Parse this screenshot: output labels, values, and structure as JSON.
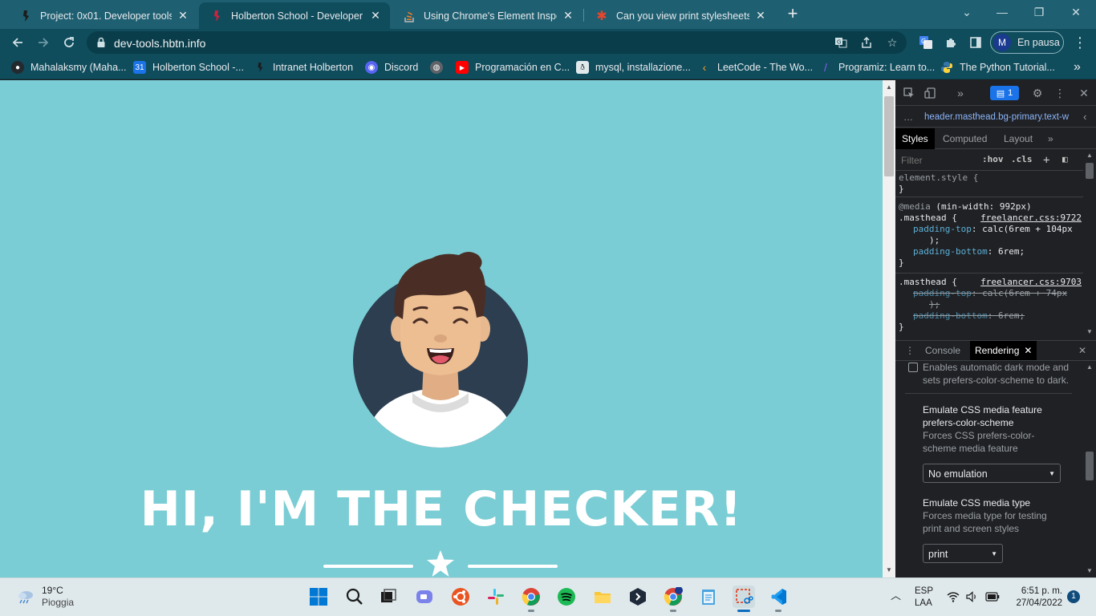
{
  "tabs": [
    {
      "title": "Project: 0x01. Developer tools | H",
      "favicon": "holberton-icon",
      "active": false
    },
    {
      "title": "Holberton School - Developer to",
      "favicon": "holberton-icon",
      "active": true
    },
    {
      "title": "Using Chrome's Element Inspecto",
      "favicon": "stackoverflow-icon",
      "active": false
    },
    {
      "title": "Can you view print stylesheets ap",
      "favicon": "asterisk-icon",
      "active": false
    }
  ],
  "toolbar": {
    "url": "dev-tools.hbtn.info",
    "profile_initial": "M",
    "profile_label": "En pausa"
  },
  "bookmarks": [
    {
      "label": "Mahalaksmy (Maha...",
      "icon": "github-icon",
      "color": "#24292e"
    },
    {
      "label": "Holberton School -...",
      "icon": "calendar-icon",
      "color": "#1a73e8"
    },
    {
      "label": "Intranet Holberton",
      "icon": "holberton-icon",
      "color": "#2b2b2b"
    },
    {
      "label": "Discord",
      "icon": "discord-icon",
      "color": "#5865f2"
    },
    {
      "label": "",
      "icon": "globe-icon",
      "color": "#5f6368"
    },
    {
      "label": "Programación en C...",
      "icon": "youtube-icon",
      "color": "#ff0000"
    },
    {
      "label": "mysql, installazione...",
      "icon": "linux-icon",
      "color": "#333333"
    },
    {
      "label": "LeetCode - The Wo...",
      "icon": "leetcode-icon",
      "color": "#333333"
    },
    {
      "label": "Programiz: Learn to...",
      "icon": "programiz-icon",
      "color": "#5a3fd8"
    },
    {
      "label": "The Python Tutorial...",
      "icon": "python-icon",
      "color": "#3776ab"
    }
  ],
  "page": {
    "headline": "HI, I'M THE CHECKER!",
    "background": "#7acdd4"
  },
  "devtools": {
    "badge_count": "1",
    "breadcrumb": "header.masthead.bg-primary.text-w",
    "subtabs": [
      "Styles",
      "Computed",
      "Layout"
    ],
    "filter_placeholder": "Filter",
    "hov": ":hov",
    "cls": ".cls",
    "styles": {
      "element_style": "element.style {",
      "close": "}",
      "media": "@media",
      "media_query": "(min-width: 992px)",
      "rule1_selector": ".masthead {",
      "rule1_source": "freelancer.css:9722",
      "rule1_prop1": "padding-top",
      "rule1_val1a": "calc(6rem + 104px",
      "rule1_val1b": ");",
      "rule1_prop2": "padding-bottom",
      "rule1_val2": "6rem;",
      "rule2_selector": ".masthead {",
      "rule2_source": "freelancer.css:9703",
      "rule2_prop1": "padding-top",
      "rule2_val1a": "calc(6rem + 74px",
      "rule2_val1b": ");",
      "rule2_prop2": "padding-bottom",
      "rule2_val2": "6rem;"
    },
    "drawer_tabs": [
      "Console",
      "Rendering"
    ],
    "rendering": {
      "dark_mode_text_1": "Enables automatic dark mode and",
      "dark_mode_text_2": "sets prefers-color-scheme to dark.",
      "scheme_title_1": "Emulate CSS media feature",
      "scheme_title_2": "prefers-color-scheme",
      "scheme_desc_1": "Forces CSS prefers-color-",
      "scheme_desc_2": "scheme media feature",
      "scheme_value": "No emulation",
      "type_title": "Emulate CSS media type",
      "type_desc_1": "Forces media type for testing",
      "type_desc_2": "print and screen styles",
      "type_value": "print"
    }
  },
  "taskbar": {
    "temp": "19°C",
    "weather": "Pioggia",
    "lang_1": "ESP",
    "lang_2": "LAA",
    "time": "6:51 p. m.",
    "date": "27/04/2022",
    "notification_count": "1"
  },
  "colors": {
    "tabstrip": "#1e5f71",
    "toolbar": "#0f4c5c",
    "page_bg": "#7acdd4",
    "avatar_bg": "#2c3e50",
    "devtools_bg": "#202124"
  }
}
